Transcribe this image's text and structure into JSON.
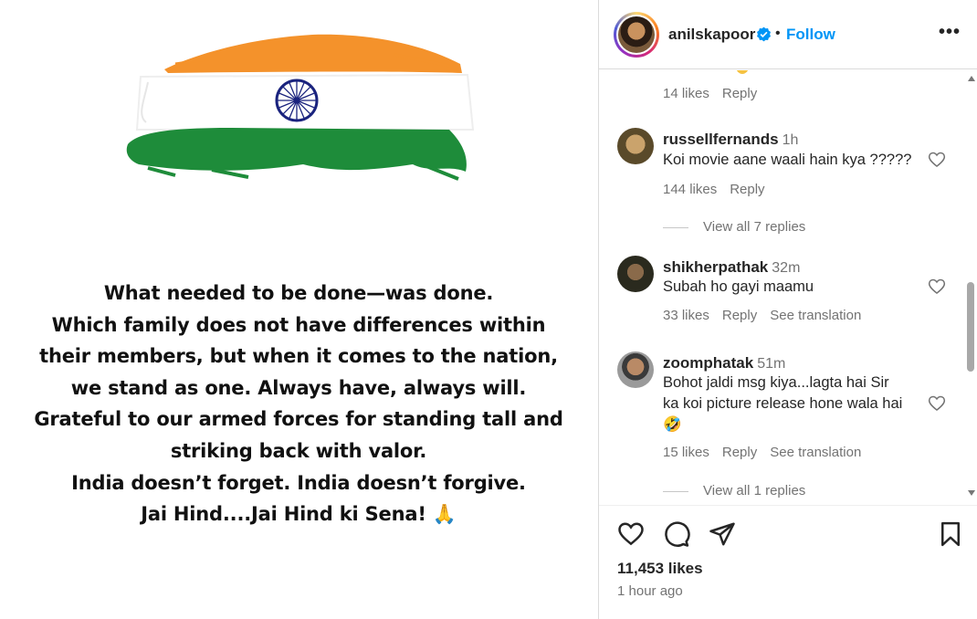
{
  "post": {
    "caption_lines": [
      "What needed to be done—was done.",
      "Which family does not have differences within",
      "their members, but when it comes to the nation,",
      "we stand as one. Always have, always will.",
      "Grateful to our armed forces for standing tall and",
      "striking back with valor.",
      "India doesn’t forget. India doesn’t forgive.",
      "Jai Hind....Jai Hind ki Sena! 🙏"
    ],
    "flag_colors": {
      "saffron": "#f4922b",
      "white": "#ffffff",
      "green": "#1e8c3a",
      "chakra": "#1a237e"
    }
  },
  "header": {
    "username": "anilskapoor",
    "separator": "•",
    "follow_label": "Follow",
    "more_label": "•••"
  },
  "comments": [
    {
      "likes": "14 likes",
      "reply": "Reply"
    },
    {
      "username": "russellfernands",
      "time": "1h",
      "text": "Koi movie aane waali hain kya ?????",
      "likes": "144 likes",
      "reply": "Reply",
      "view_replies": "View all 7 replies"
    },
    {
      "username": "shikherpathak",
      "time": "32m",
      "text": "Subah ho gayi maamu",
      "likes": "33 likes",
      "reply": "Reply",
      "translation": "See translation"
    },
    {
      "username": "zoomphatak",
      "time": "51m",
      "text_line1": "Bohot jaldi msg kiya...lagta hai Sir",
      "text_line2": "ka koi picture release hone wala hai",
      "emoji": "🤣",
      "likes": "15 likes",
      "reply": "Reply",
      "translation": "See translation",
      "view_replies": "View all 1 replies"
    }
  ],
  "footer": {
    "likes_count": "11,453 likes",
    "time_ago": "1 hour ago"
  },
  "colors": {
    "accent": "#0095f6",
    "muted": "#737373",
    "text": "#262626"
  }
}
